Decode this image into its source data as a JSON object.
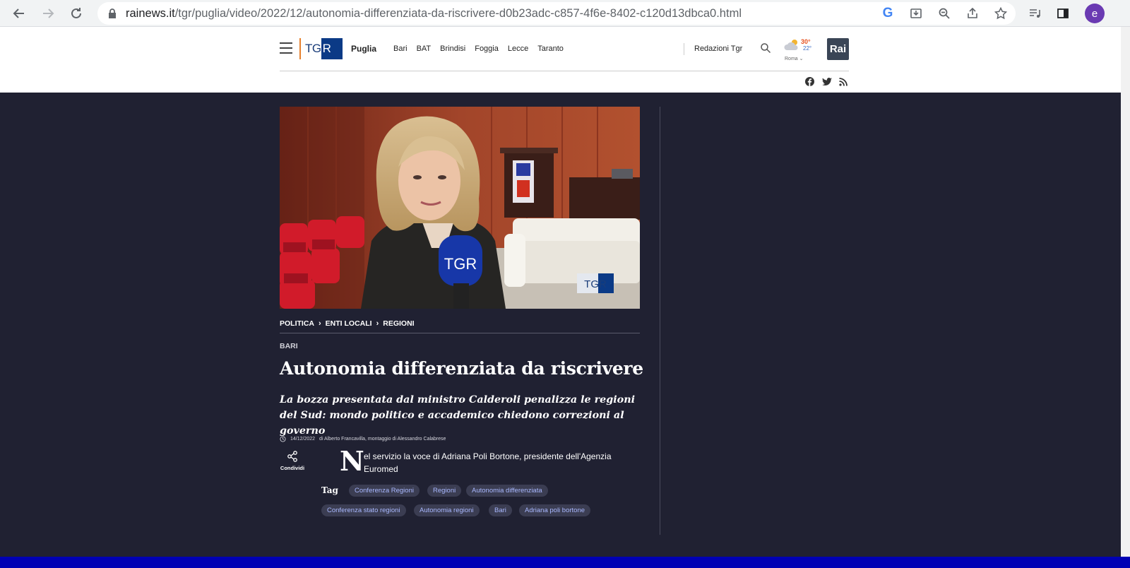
{
  "browser": {
    "url_host": "rainews.it",
    "url_path": "/tgr/puglia/video/2022/12/autonomia-differenziata-da-riscrivere-d0b23adc-c857-4f6e-8402-c120d13dbca0.html",
    "avatar_letter": "e",
    "google_letter": "G"
  },
  "header": {
    "logo_text": "TG",
    "logo_block": "R",
    "region": "Puglia",
    "cities": [
      "Bari",
      "BAT",
      "Brindisi",
      "Foggia",
      "Lecce",
      "Taranto"
    ],
    "redazioni": "Redazioni Tgr",
    "weather": {
      "high": "30°",
      "low": "22°",
      "city": "Roma"
    },
    "rai_logo": "Rai"
  },
  "article": {
    "breadcrumb": [
      "POLITICA",
      "ENTI LOCALI",
      "REGIONI"
    ],
    "place": "BARI",
    "title": "Autonomia differenziata da riscrivere",
    "subtitle": "La bozza presentata dal ministro Calderoli penalizza le regioni del Sud: mondo politico e accademico chiedono correzioni al governo",
    "date": "14/12/2022",
    "author": "di Alberto Francavilla, montaggio di Alessandro Calabrese",
    "share_label": "Condividi",
    "dropcap": "N",
    "body": "el servizio la voce di Adriana Poli Bortone, presidente dell'Agenzia Euromed",
    "tag_label": "Tag",
    "tags": [
      "Conferenza Regioni",
      "Regioni",
      "Autonomia differenziata",
      "Conferenza stato regioni",
      "Autonomia regioni",
      "Bari",
      "Adriana poli bortone"
    ],
    "mic_logo": "TGR",
    "video_watermark": "TGR"
  },
  "colors": {
    "background_dark": "#202132",
    "tag_bg": "#3b3d52",
    "tag_text": "#a9b8ff",
    "tgr_blue": "#0b3a86",
    "footer_blue": "#0000b4"
  }
}
